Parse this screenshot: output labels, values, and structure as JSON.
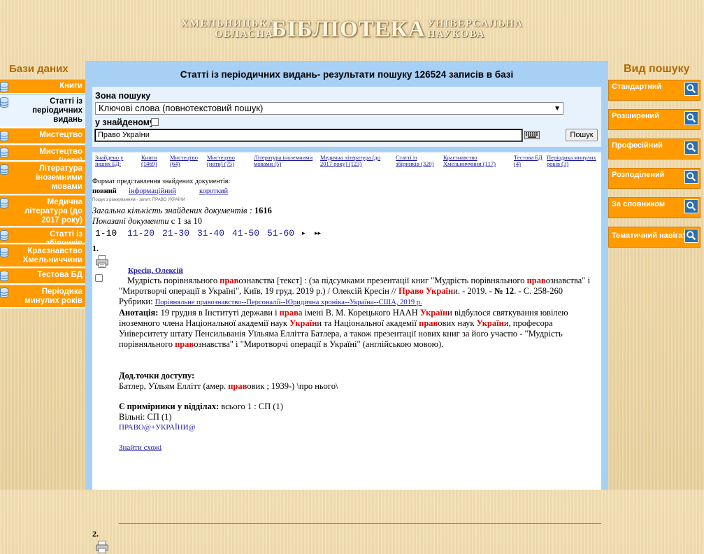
{
  "header": {
    "logo_left_top": "ХМЕЛЬНИЦЬКА",
    "logo_left_bottom": "ОБЛАСНА",
    "logo_main": "БІБЛІОТЕКА",
    "logo_right_top": "УНІВЕРСАЛЬНА",
    "logo_right_bottom": "НАУКОВА"
  },
  "left_sidebar": {
    "title": "Бази даних",
    "items": [
      {
        "label": "Книги",
        "active": false
      },
      {
        "label": "Статті із періодичних видань",
        "active": true
      },
      {
        "label": "Мистецтво",
        "active": false
      },
      {
        "label": "Мистецтво (ноти)",
        "active": false
      },
      {
        "label": "Література іноземними мовами",
        "active": false
      },
      {
        "label": "Медична література (до 2017 року)",
        "active": false
      },
      {
        "label": "Статті із збірників",
        "active": false
      },
      {
        "label": "Краєзнавство Хмельниччини",
        "active": false
      },
      {
        "label": "Тестова БД",
        "active": false
      },
      {
        "label": "Періодика минулих років",
        "active": false
      }
    ]
  },
  "right_sidebar": {
    "title": "Вид пошуку",
    "items": [
      "Стандартний",
      "Розширений",
      "Професійний",
      "Розподілений",
      "За словником",
      "Тематичний навігатор"
    ]
  },
  "main": {
    "title": "Статті із періодичних видань- результати пошуку 126524 записів в базі",
    "search": {
      "zone_label": "Зона пошуку",
      "zone_value": "Ключові слова (повнотекстовий пошук)",
      "found_label": "у знайденому",
      "query_value": "Право України",
      "button_label": "Пошук"
    },
    "db_counts": [
      {
        "label": "Знайдено у інших БД:"
      },
      {
        "label": "Книги (1469)"
      },
      {
        "label": "Мистецтво (64)"
      },
      {
        "label": "Мистецтво (ноти) (75)"
      },
      {
        "label": "Література іноземними мовами (5)"
      },
      {
        "label": "Медична література (до 2017 року) (123)"
      },
      {
        "label": "Статті із збірників (320)"
      },
      {
        "label": "Краєзнавство Хмельниччини (117)"
      },
      {
        "label": "Тестова БД (4)"
      },
      {
        "label": "Періодика минулих років (3)"
      }
    ],
    "results": {
      "format_label": "Формат представлення знайдених документів:",
      "format_full": "повний",
      "format_info": "інформаційний",
      "format_short": "короткий",
      "rank_note": "Пошук з ранжуванням - запит: ПРАВО УКРАЇНИ",
      "total_label": "Загальна кількість знайдених документів",
      "total_value": "1616",
      "shown_label": "Показані документи",
      "shown_value": "с 1 за 10",
      "pages": [
        "1-10",
        "11-20",
        "21-30",
        "31-40",
        "41-50",
        "51-60"
      ],
      "arrow_next": "▸",
      "arrow_last": "▸▸",
      "record1": {
        "number": "1.",
        "author": "Кресін, Олексій",
        "title_text_a": "Мудрість порівняльного ",
        "title_hl1": "прав",
        "title_text_b": "ознавства [текст] : (за підсумками презентації книг \"Мудрість порівняльного ",
        "title_hl2": "прав",
        "title_text_c": "ознавства\" і \"Миротворчі операції в Україні\", Київ, 19 груд. 2019 р.) / Олексій Кресін // ",
        "title_hl3": "Право Україн",
        "title_text_d": "и. - 2019. - ",
        "title_num": "№ 12",
        "title_text_e": ". - С. 258-260",
        "rubric_label": "Рубрики:",
        "rubric_value": "Порівняльне правознавство--Персоналії--Юридична хроніка--Україна--США, 2019 р.",
        "annotation_label": "Анотація:",
        "annotation_a": " 19 грудня в Інституті держави і ",
        "annotation_hl1": "прав",
        "annotation_b": "а імені В. М. Корецького НААН ",
        "annotation_hl2": "Україн",
        "annotation_c": "и відбулося святкування ювілею іноземного члена Національної академії наук ",
        "annotation_hl3": "Україн",
        "annotation_d": "и та Національної академії ",
        "annotation_hl4": "прав",
        "annotation_e": "ових наук ",
        "annotation_hl5": "Україн",
        "annotation_f": "и, професора Університету штату Пенсильванія Уїльяма Еллітта Батлера, а також презентації нових книг за його участю - \"Мудрість порівняльного ",
        "annotation_hl6": "прав",
        "annotation_g": "ознавства\" і \"Миротворчі операції в Україні\" (англійською мовою).",
        "access_label": "Дод.точки доступу:",
        "access_a": "Батлер, Уїльям Еллітт (амер. ",
        "access_hl": "прав",
        "access_b": "овик ; 1939-) \\про нього\\",
        "copies_label": "Є примірники у відділах:",
        "copies_value": " всього 1 : СП (1)",
        "free_value": "Вільні: СП (1)",
        "tag_link": "ПРАВО@+УКРАЇНИ@",
        "similar_link": "Знайти схожі"
      },
      "record2": {
        "number": "2."
      }
    }
  }
}
